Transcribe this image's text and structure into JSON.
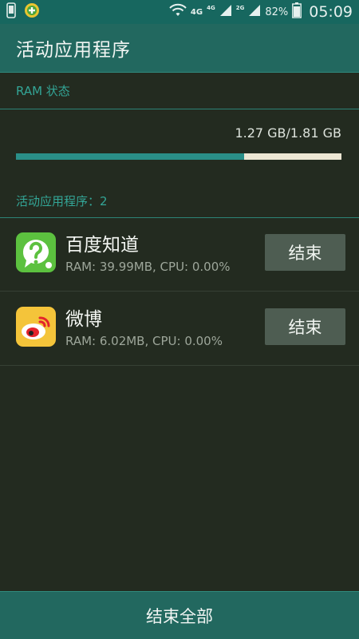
{
  "status_bar": {
    "network_1": "4G",
    "network_2": "4G",
    "network_3": "2G",
    "battery": "82%",
    "time": "05:09"
  },
  "header": {
    "title": "活动应用程序"
  },
  "ram": {
    "section_label": "RAM 状态",
    "usage_text": "1.27 GB/1.81 GB",
    "used_fraction": 0.7
  },
  "apps": {
    "section_label": "活动应用程序：2",
    "items": [
      {
        "name": "百度知道",
        "stats": "RAM: 39.99MB, CPU: 0.00%",
        "end_label": "结束",
        "icon": "baidu-zhidao-icon"
      },
      {
        "name": "微博",
        "stats": "RAM: 6.02MB, CPU: 0.00%",
        "end_label": "结束",
        "icon": "weibo-icon"
      }
    ]
  },
  "footer": {
    "end_all_label": "结束全部"
  },
  "colors": {
    "accent": "#22685f",
    "background": "#232b20",
    "ram_fill": "#2a8f88",
    "ram_track": "#ece6d3",
    "button": "#4e5d52"
  }
}
